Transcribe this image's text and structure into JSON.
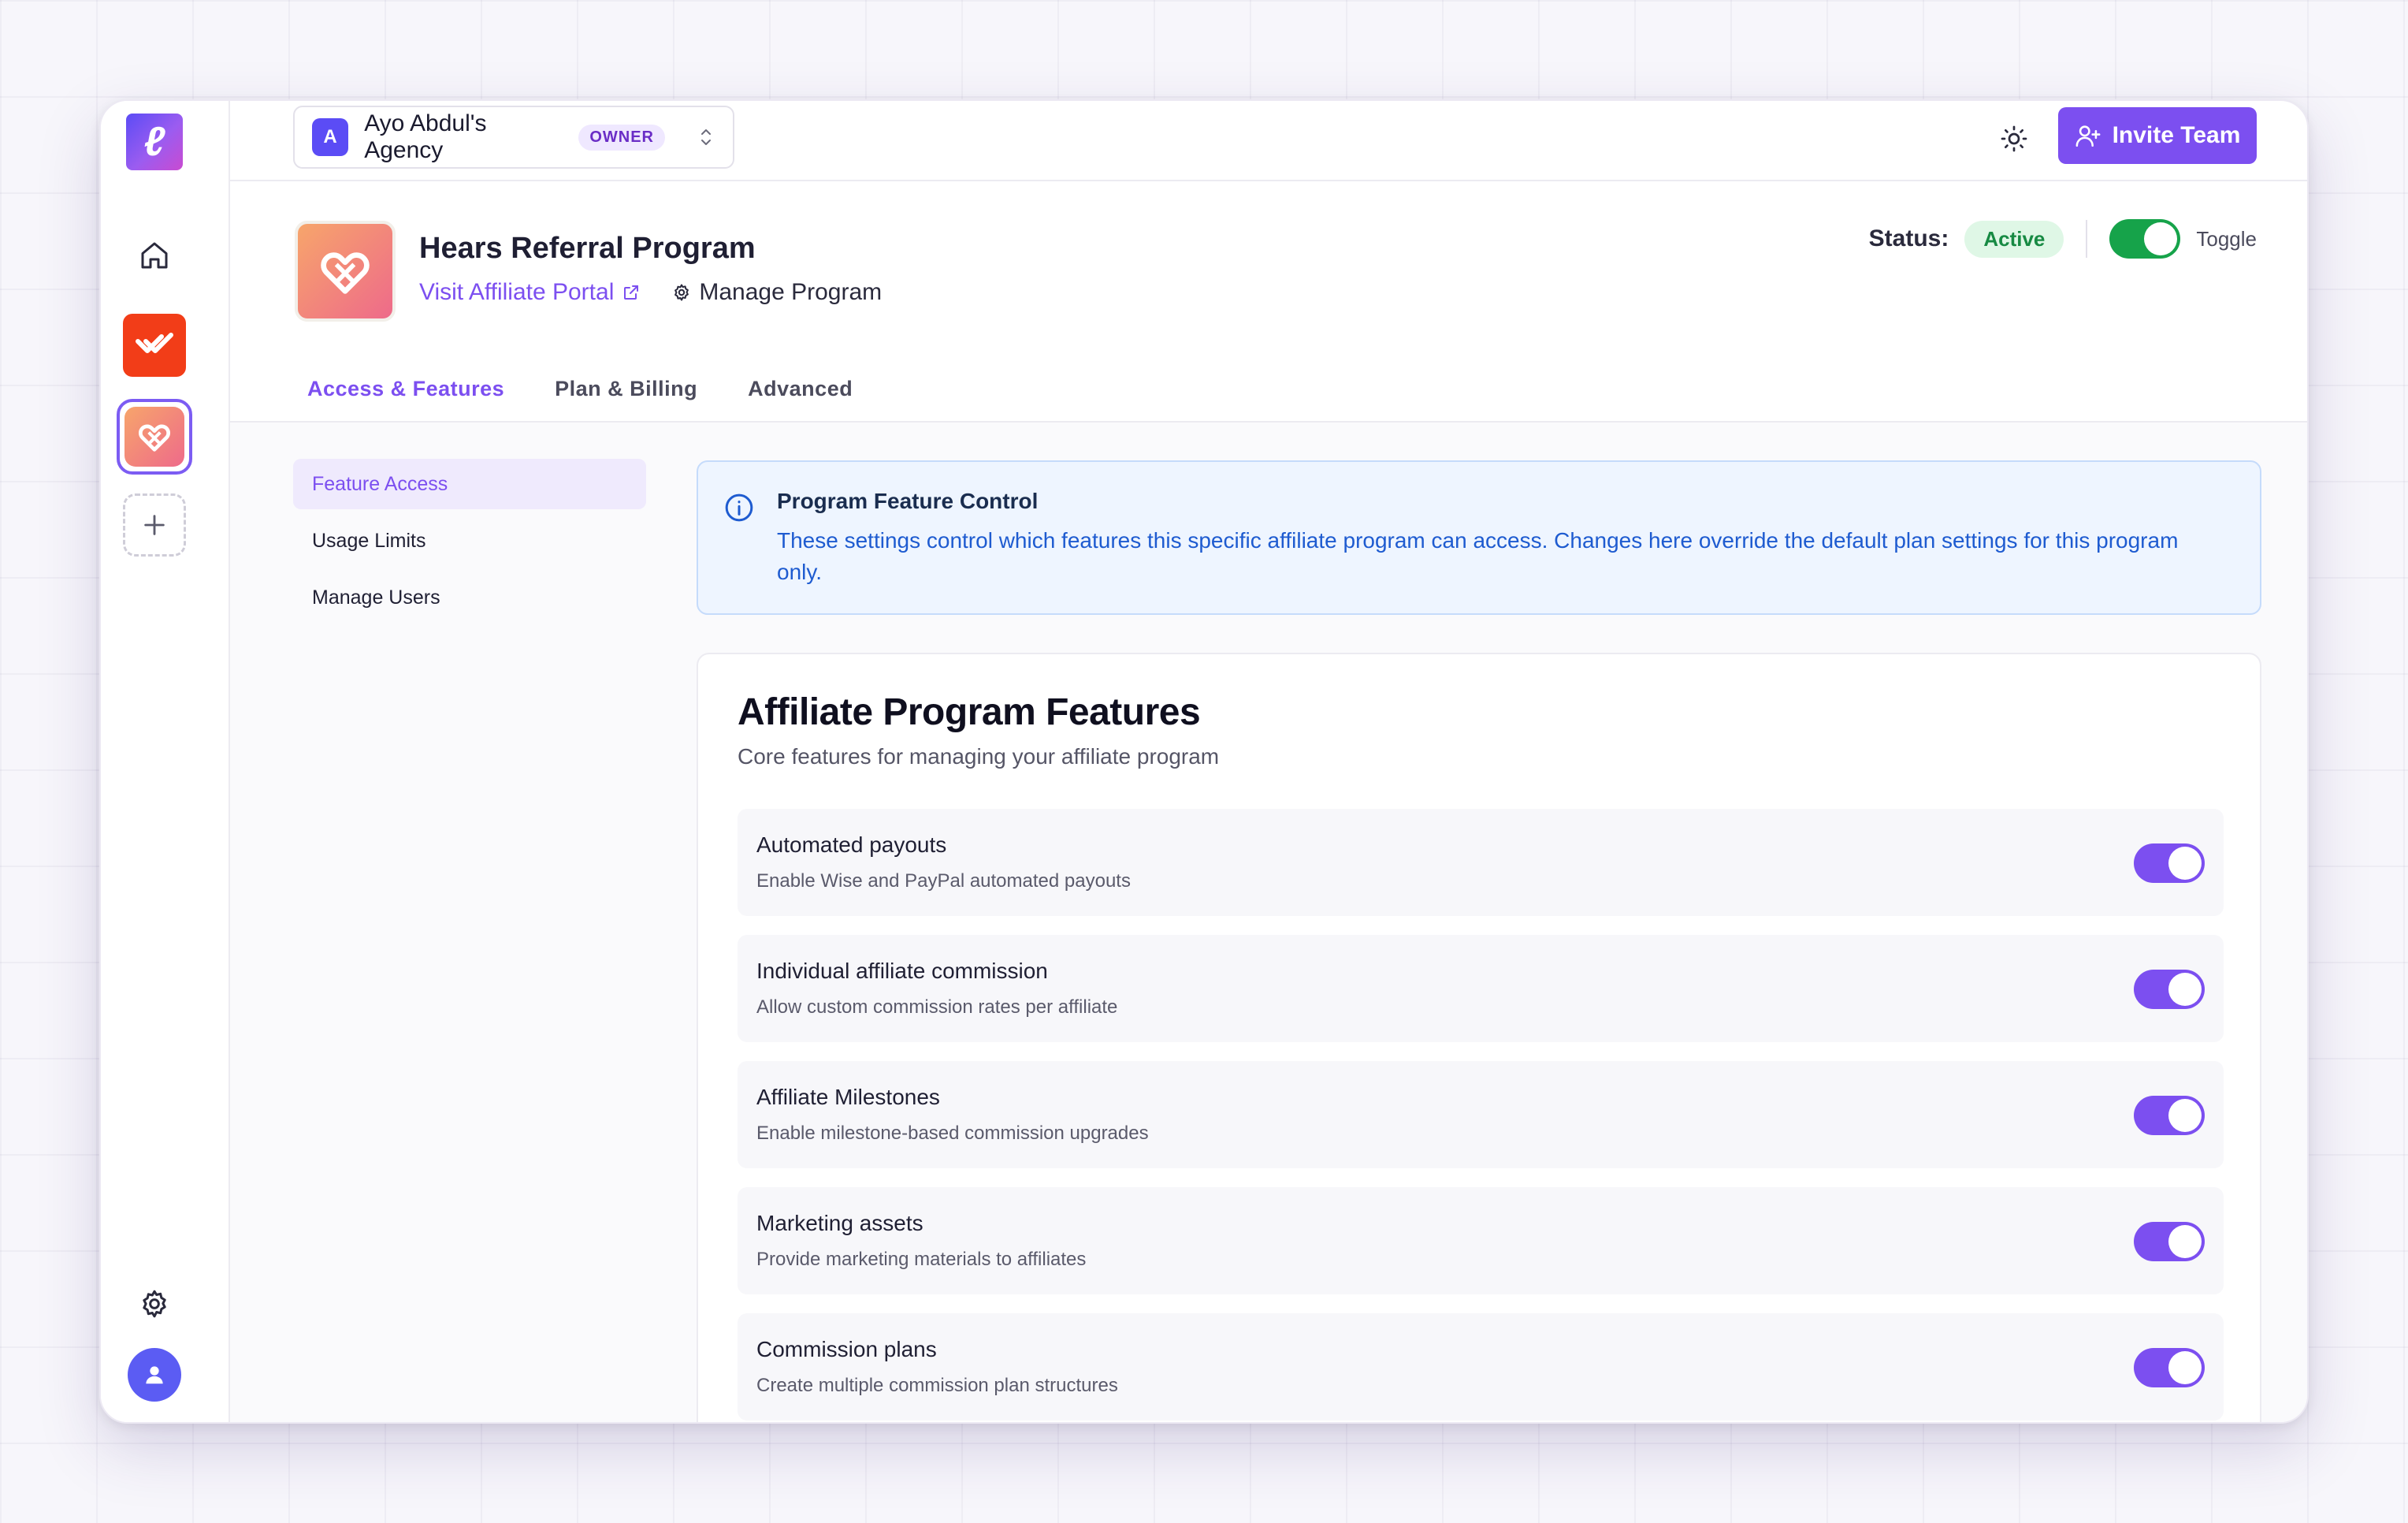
{
  "colors": {
    "accent": "#7c4ff0",
    "active_green": "#16a34a",
    "info_blue": "#1e5bd0",
    "rail_app_red": "#f23d18"
  },
  "rail": {
    "logo_glyph": "ℓ",
    "items": [
      "home-icon",
      "app-red-logo",
      "app-hears-logo",
      "plus-icon"
    ],
    "bottom": [
      "gear-icon",
      "user-icon"
    ]
  },
  "topbar": {
    "org_initial": "A",
    "org_name": "Ayo Abdul's Agency",
    "org_role": "OWNER",
    "invite_label": "Invite Team"
  },
  "program": {
    "title": "Hears Referral Program",
    "visit_label": "Visit Affiliate Portal",
    "manage_label": "Manage Program",
    "status_label": "Status:",
    "status_value": "Active",
    "toggle_label": "Toggle",
    "enabled": true
  },
  "tabs": [
    {
      "label": "Access & Features",
      "active": true
    },
    {
      "label": "Plan & Billing",
      "active": false
    },
    {
      "label": "Advanced",
      "active": false
    }
  ],
  "subnav": [
    {
      "label": "Feature Access",
      "active": true
    },
    {
      "label": "Usage Limits",
      "active": false
    },
    {
      "label": "Manage Users",
      "active": false
    }
  ],
  "info": {
    "title": "Program Feature Control",
    "text": "These settings control which features this specific affiliate program can access. Changes here override the default plan settings for this program only."
  },
  "features": {
    "title": "Affiliate Program Features",
    "subtitle": "Core features for managing your affiliate program",
    "items": [
      {
        "name": "Automated payouts",
        "desc": "Enable Wise and PayPal automated payouts",
        "enabled": true
      },
      {
        "name": "Individual affiliate commission",
        "desc": "Allow custom commission rates per affiliate",
        "enabled": true
      },
      {
        "name": "Affiliate Milestones",
        "desc": "Enable milestone-based commission upgrades",
        "enabled": true
      },
      {
        "name": "Marketing assets",
        "desc": "Provide marketing materials to affiliates",
        "enabled": true
      },
      {
        "name": "Commission plans",
        "desc": "Create multiple commission plan structures",
        "enabled": true
      }
    ]
  }
}
